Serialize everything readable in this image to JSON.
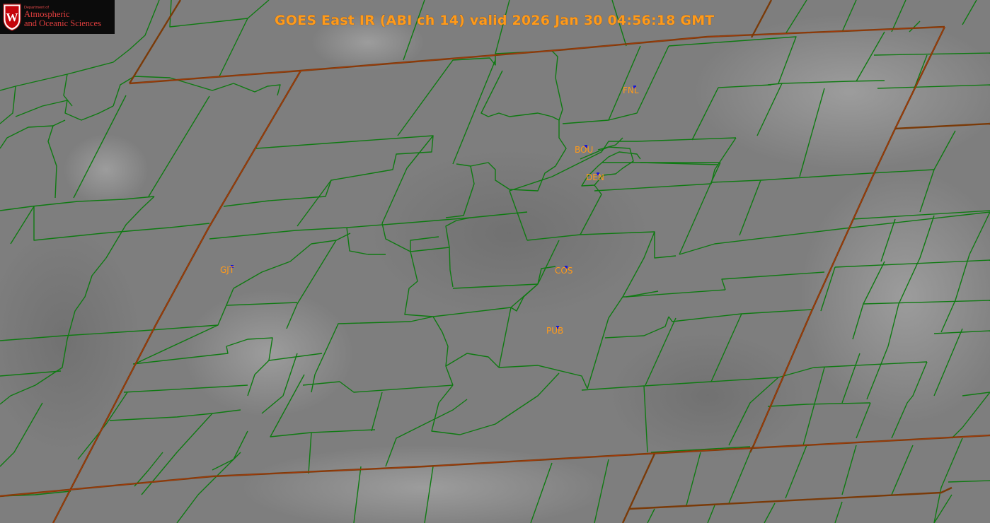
{
  "title": "GOES East IR (ABI ch 14) valid 2026 Jan 30 04:56:18 GMT",
  "logo": {
    "dept": "Department of",
    "line1": "Atmospheric",
    "line2": "and Oceanic Sciences",
    "crest_letter": "W"
  },
  "stations": [
    {
      "id": "fnl",
      "label": "FNL"
    },
    {
      "id": "bou",
      "label": "BOU"
    },
    {
      "id": "den",
      "label": "DEN"
    },
    {
      "id": "gjt",
      "label": "GJT"
    },
    {
      "id": "cos",
      "label": "COS"
    },
    {
      "id": "pub",
      "label": "PUB"
    }
  ],
  "colors": {
    "county_border": "#0f7a12",
    "state_border": "#7a3a08",
    "label": "#ff9a1a",
    "station_marker": "#1a1ad6",
    "logo_text": "#e03e3e"
  }
}
